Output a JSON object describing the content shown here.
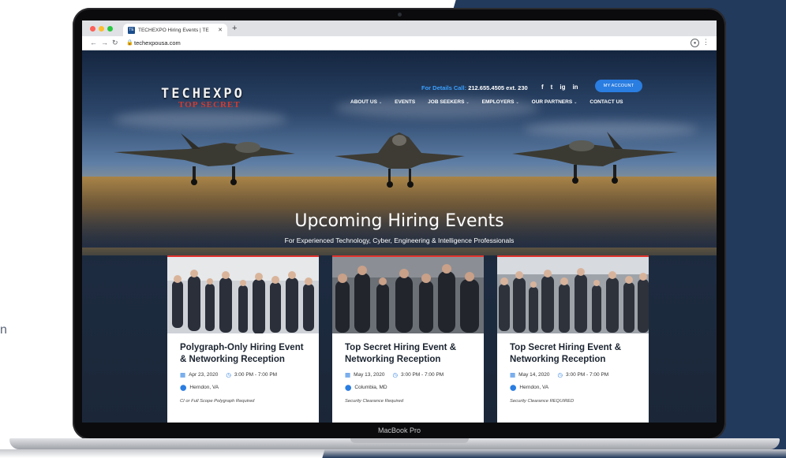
{
  "background": {
    "cut_text": "n"
  },
  "laptop": {
    "label": "MacBook Pro"
  },
  "browser": {
    "tab_title": "TECHEXPO Hiring Events | TE",
    "favicon_text": "TE",
    "url": "techexpousa.com"
  },
  "site": {
    "logo_main": "TECHEXPO",
    "logo_sub": "TOP SECRET",
    "phone_label": "For Details Call:",
    "phone_number": "212.655.4505 ext. 230",
    "social": [
      "f",
      "t",
      "ig",
      "in"
    ],
    "account_button": "MY ACCOUNT",
    "nav": [
      {
        "label": "ABOUT US",
        "dropdown": true
      },
      {
        "label": "EVENTS",
        "dropdown": false
      },
      {
        "label": "JOB SEEKERS",
        "dropdown": true
      },
      {
        "label": "EMPLOYERS",
        "dropdown": true
      },
      {
        "label": "OUR PARTNERS",
        "dropdown": true
      },
      {
        "label": "CONTACT US",
        "dropdown": false
      }
    ],
    "hero_title": "Upcoming Hiring Events",
    "hero_subtitle": "For Experienced Technology, Cyber, Engineering & Intelligence Professionals",
    "events": [
      {
        "title": "Polygraph-Only Hiring Event & Networking Reception",
        "date": "Apr 23, 2020",
        "time": "3:00 PM - 7:00 PM",
        "location": "Herndon, VA",
        "requirement": "CI or Full Scope Polygraph Required"
      },
      {
        "title": "Top Secret Hiring Event & Networking Reception",
        "date": "May 13, 2020",
        "time": "3:00 PM - 7:00 PM",
        "location": "Columbia, MD",
        "requirement": "Security Clearance Required"
      },
      {
        "title": "Top Secret Hiring Event & Networking Reception",
        "date": "May 14, 2020",
        "time": "3:00 PM - 7:00 PM",
        "location": "Herndon, VA",
        "requirement": "Security Clearance REQUIRED"
      }
    ]
  },
  "colors": {
    "accent_blue": "#2a7de1",
    "card_top_red": "#e2332f",
    "navy": "#223a5c"
  }
}
